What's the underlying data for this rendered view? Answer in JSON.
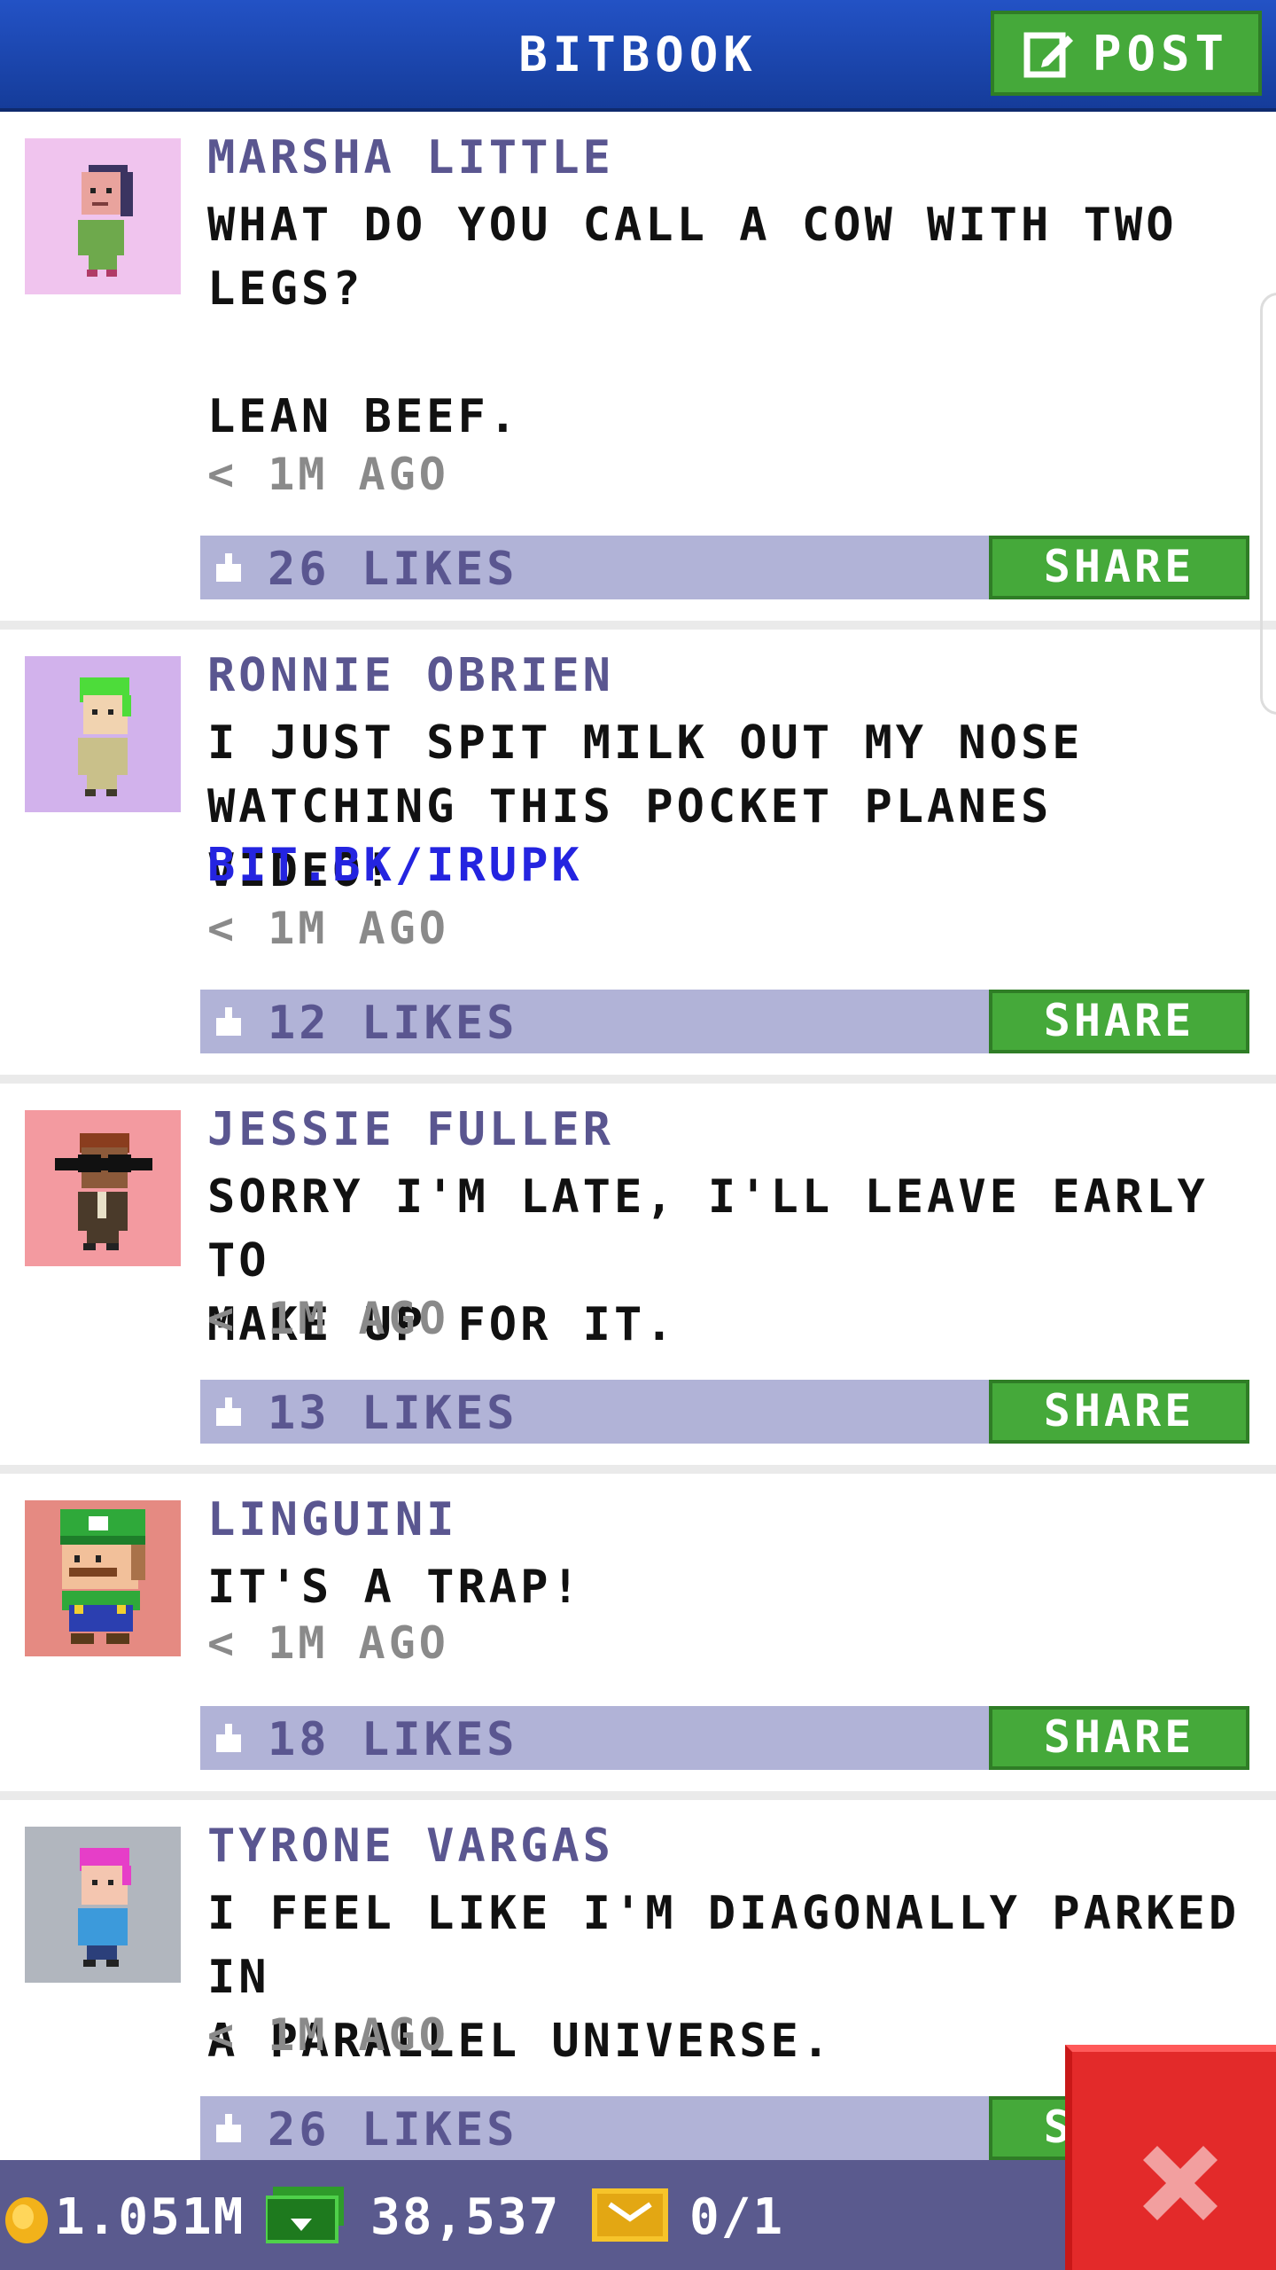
{
  "header": {
    "title": "BITBOOK",
    "post_label": "POST"
  },
  "posts": [
    {
      "name": "MARSHA LITTLE",
      "message": "WHAT DO YOU CALL A COW WITH TWO\nLEGS?\n\nLEAN BEEF.",
      "link": "",
      "time": "< 1M AGO",
      "likes": "26 LIKES",
      "share": "SHARE",
      "avatar_bg": "#f0c4ee"
    },
    {
      "name": "RONNIE OBRIEN",
      "message": "I JUST SPIT MILK OUT MY NOSE\nWATCHING THIS POCKET PLANES VIDEO!",
      "link": "BIT.BK/IRUPK",
      "time": "< 1M AGO",
      "likes": "12 LIKES",
      "share": "SHARE",
      "avatar_bg": "#d2b2ec"
    },
    {
      "name": "JESSIE FULLER",
      "message": "SORRY I'M LATE, I'LL LEAVE EARLY TO\nMAKE UP FOR IT.",
      "link": "",
      "time": "< 1M AGO",
      "likes": "13 LIKES",
      "share": "SHARE",
      "avatar_bg": "#f39aa0"
    },
    {
      "name": "LINGUINI",
      "message": "IT'S A TRAP!",
      "link": "",
      "time": "< 1M AGO",
      "likes": "18 LIKES",
      "share": "SHARE",
      "avatar_bg": "#e58a82"
    },
    {
      "name": "TYRONE VARGAS",
      "message": "I FEEL LIKE I'M DIAGONALLY PARKED IN\nA PARALLEL UNIVERSE.",
      "link": "",
      "time": "< 1M AGO",
      "likes": "26 LIKES",
      "share": "SHARE",
      "avatar_bg": "#b1b6be"
    }
  ],
  "status_bar": {
    "coins": "1.051M",
    "bux": "38,537",
    "tickets": "0/1"
  },
  "colors": {
    "header_blue": "#1e4ab3",
    "share_green": "#45a93a",
    "like_bar": "#b1b3d7",
    "name_purple": "#5a5690",
    "close_red": "#e32a2a"
  }
}
